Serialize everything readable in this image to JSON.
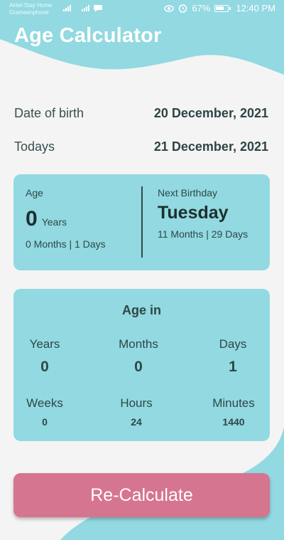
{
  "status_bar": {
    "carrier_1": "Airtel-Stay Home",
    "carrier_2": "Grameenphone",
    "battery": "67%",
    "time": "12:40 PM"
  },
  "app": {
    "title": "Age Calculator"
  },
  "dates": {
    "birth_label": "Date of birth",
    "birth_value": "20 December, 2021",
    "today_label": "Todays",
    "today_value": "21 December, 2021"
  },
  "age_card": {
    "age_label": "Age",
    "years_value": "0",
    "years_unit": "Years",
    "months_days": "0 Months | 1 Days",
    "next_label": "Next Birthday",
    "next_weekday": "Tuesday",
    "remaining": "11 Months | 29 Days"
  },
  "age_in": {
    "title": "Age in",
    "years_label": "Years",
    "years_value": "0",
    "months_label": "Months",
    "months_value": "0",
    "days_label": "Days",
    "days_value": "1",
    "weeks_label": "Weeks",
    "weeks_value": "0",
    "hours_label": "Hours",
    "hours_value": "24",
    "minutes_label": "Minutes",
    "minutes_value": "1440"
  },
  "actions": {
    "recalculate_label": "Re-Calculate"
  },
  "colors": {
    "accent_teal": "#92d9e1",
    "button_pink": "#d67590",
    "background": "#f4f4f4"
  }
}
